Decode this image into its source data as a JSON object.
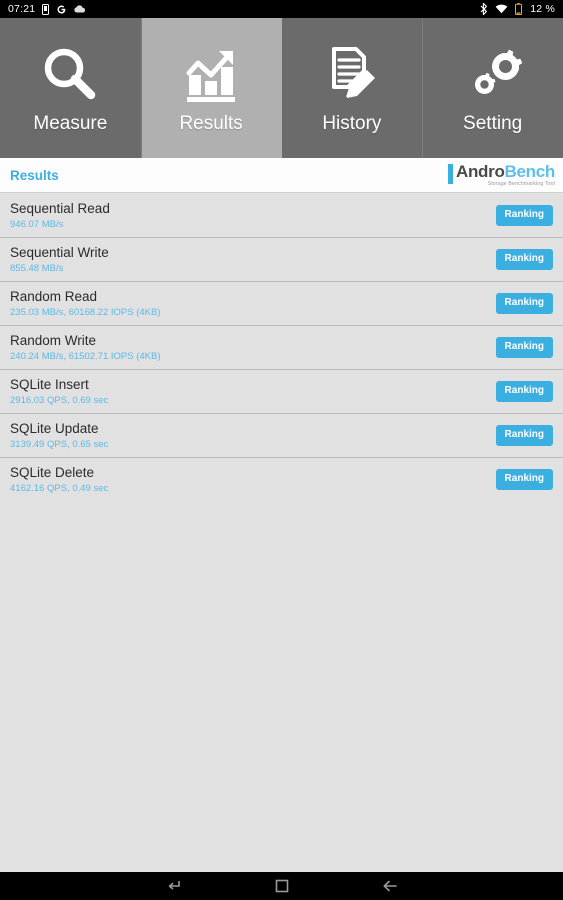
{
  "statusbar": {
    "clock": "07:21",
    "battery_percent": "12 %",
    "left_icons": [
      "sim-card-icon",
      "google-icon",
      "cloud-icon"
    ],
    "right_icons": [
      "bluetooth-icon",
      "wifi-icon",
      "battery-icon"
    ]
  },
  "tabs": [
    {
      "label": "Measure",
      "icon": "magnifier-icon",
      "active": false
    },
    {
      "label": "Results",
      "icon": "bar-chart-icon",
      "active": true
    },
    {
      "label": "History",
      "icon": "document-pencil-icon",
      "active": false
    },
    {
      "label": "Setting",
      "icon": "gears-icon",
      "active": false
    }
  ],
  "header": {
    "title": "Results",
    "logo_andro": "Andro",
    "logo_bench": "Bench",
    "logo_subtitle": "Storage Benchmarking Tool"
  },
  "colors": {
    "accent_blue": "#3bafe0",
    "value_blue": "#5bb9e8",
    "tab_inactive": "#6b6b6b",
    "tab_active": "#b0b0b0",
    "list_bg": "#e1e1e1"
  },
  "results": [
    {
      "name": "Sequential Read",
      "value": "946.07 MB/s",
      "button": "Ranking"
    },
    {
      "name": "Sequential Write",
      "value": "855.48 MB/s",
      "button": "Ranking"
    },
    {
      "name": "Random Read",
      "value": "235.03 MB/s, 60168.22 IOPS (4KB)",
      "button": "Ranking"
    },
    {
      "name": "Random Write",
      "value": "240.24 MB/s, 61502.71 IOPS (4KB)",
      "button": "Ranking"
    },
    {
      "name": "SQLite Insert",
      "value": "2916.03 QPS, 0.69 sec",
      "button": "Ranking"
    },
    {
      "name": "SQLite Update",
      "value": "3139.49 QPS, 0.65 sec",
      "button": "Ranking"
    },
    {
      "name": "SQLite Delete",
      "value": "4162.16 QPS, 0.49 sec",
      "button": "Ranking"
    }
  ],
  "navbar": {
    "buttons": [
      {
        "name": "switch-app-icon"
      },
      {
        "name": "home-square-icon"
      },
      {
        "name": "back-arrow-icon"
      }
    ]
  }
}
